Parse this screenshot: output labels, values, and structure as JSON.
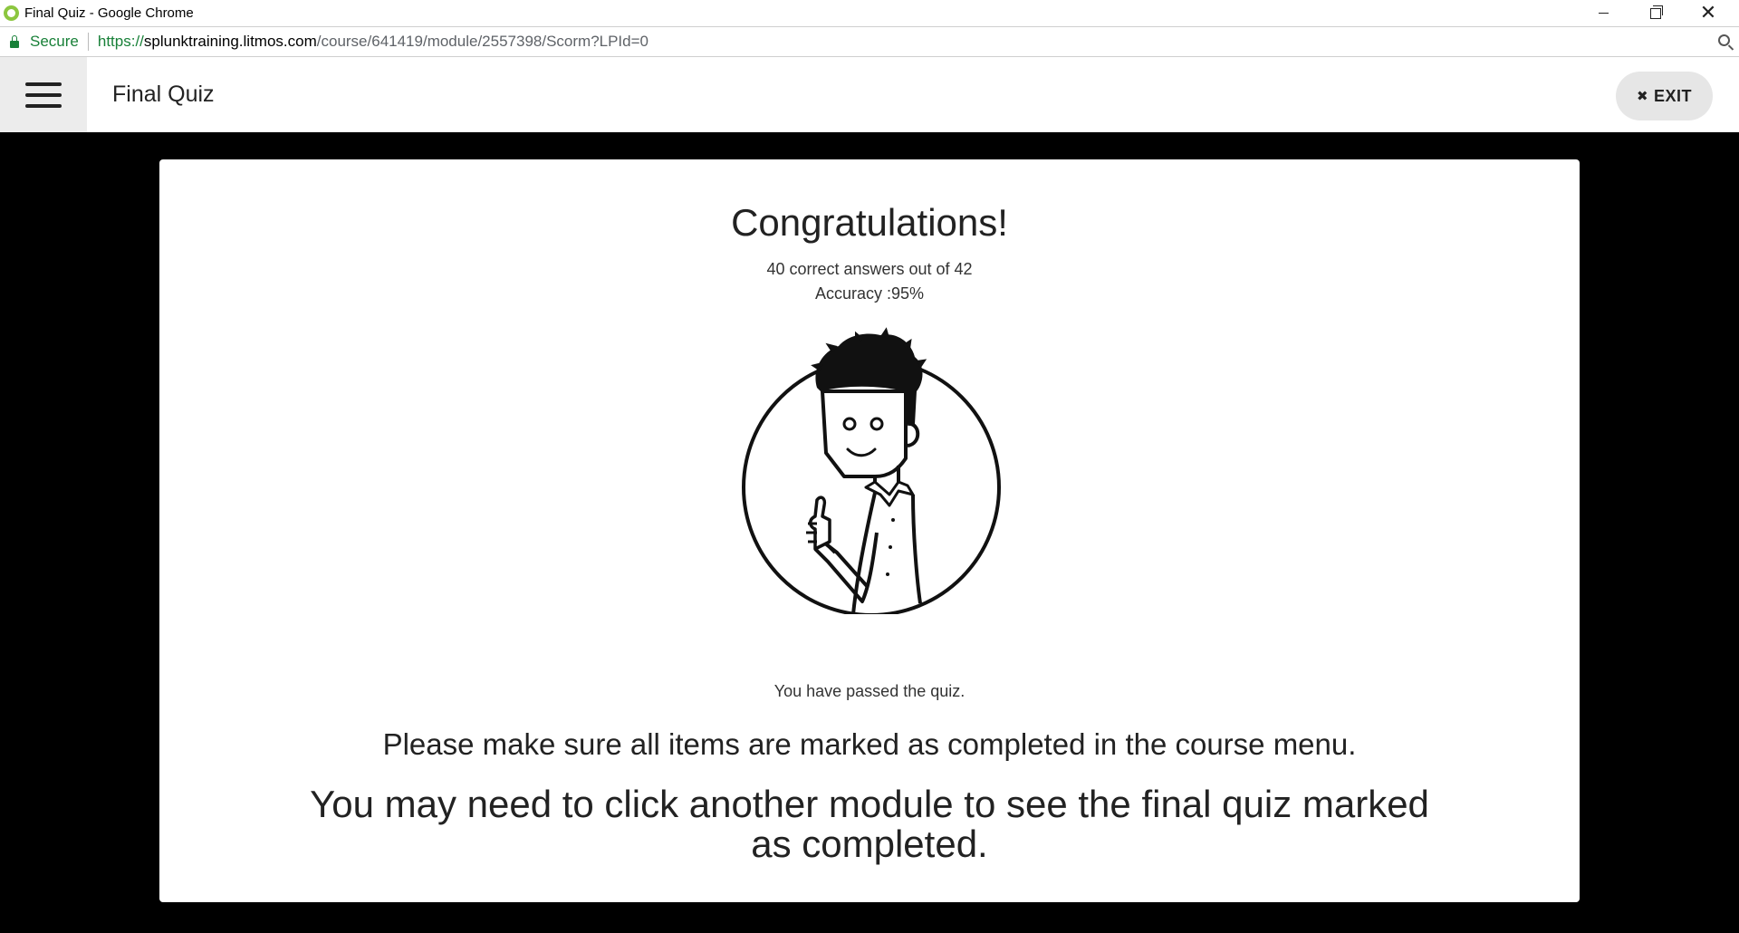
{
  "browser": {
    "window_title": "Final Quiz - Google Chrome",
    "secure_label": "Secure",
    "url_scheme": "https://",
    "url_host": "splunktraining.litmos.com",
    "url_path": "/course/641419/module/2557398/Scorm?LPId=0"
  },
  "header": {
    "menu_icon": "hamburger-menu-icon",
    "title": "Final Quiz",
    "exit_icon": "close-icon",
    "exit_label": "EXIT"
  },
  "result": {
    "heading": "Congratulations!",
    "score_text": "40 correct answers out of 42",
    "accuracy_text": "Accuracy :95%",
    "correct": 40,
    "total": 42,
    "accuracy_percent": 95,
    "illustration": "thumbs-up-character-illustration",
    "passed_text": "You have passed the quiz.",
    "message_1": "Please make sure all items are marked as completed in the course menu.",
    "message_2": "You may need to click another module to see the final quiz marked as completed."
  },
  "colors": {
    "secure_green": "#188038",
    "background": "#000000",
    "card": "#ffffff",
    "exit_button_bg": "#e6e6e6"
  }
}
